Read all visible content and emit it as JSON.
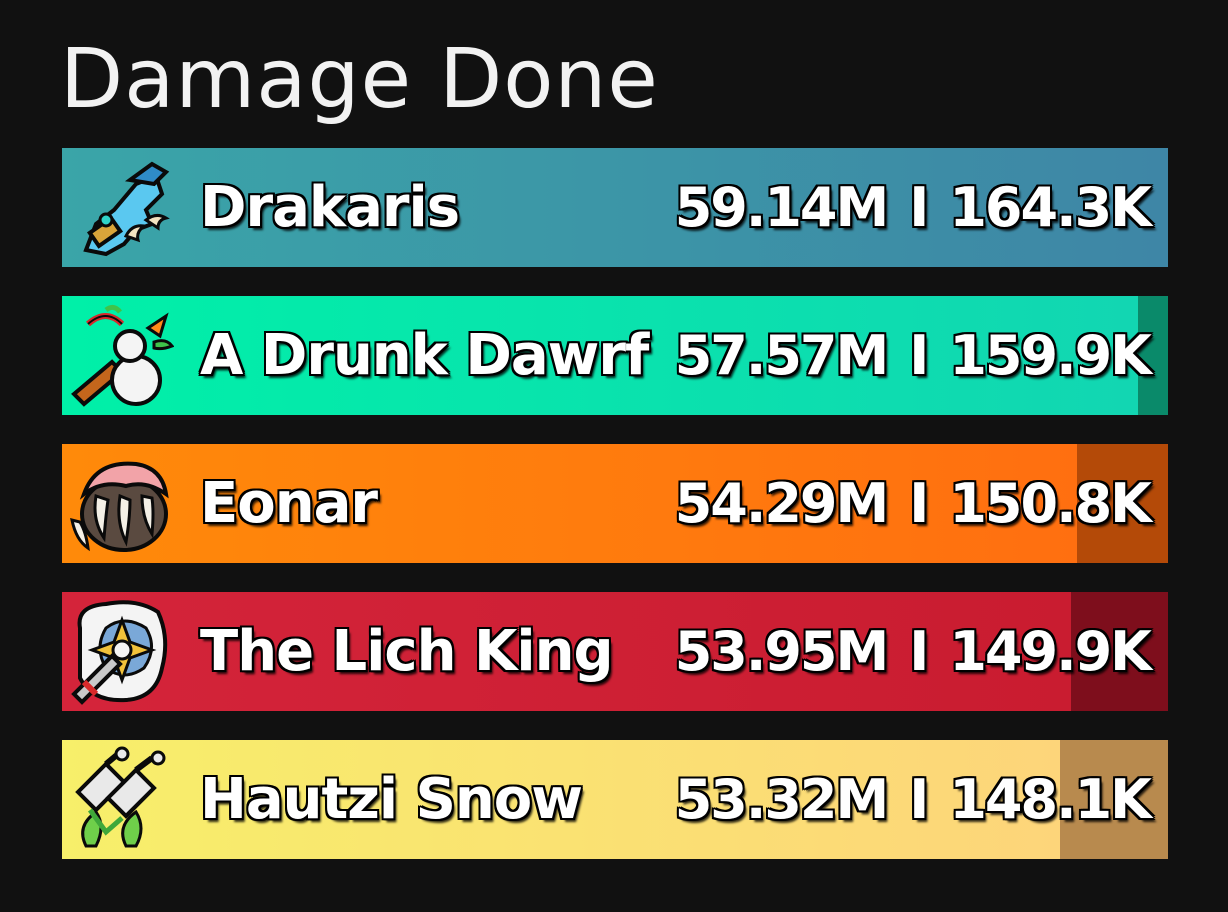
{
  "meter": {
    "title": "Damage Done",
    "separator": "I",
    "entries": [
      {
        "name": "Drakaris",
        "total": "59.14M",
        "per_second": "164.3K",
        "fill_fraction": 1.0,
        "color_light": "#3aa5a8",
        "color_dark": "#3e86a6",
        "rest_color": "#2f6f8a",
        "icon": "mage-hand-icon"
      },
      {
        "name": "A Drunk Dawrf",
        "total": "57.57M",
        "per_second": "159.9K",
        "fill_fraction": 0.973,
        "color_light": "#00f0a8",
        "color_dark": "#12d6b2",
        "rest_color": "#0a8a6a",
        "icon": "monk-gourd-icon"
      },
      {
        "name": "Eonar",
        "total": "54.29M",
        "per_second": "150.8K",
        "fill_fraction": 0.918,
        "color_light": "#ff8a0a",
        "color_dark": "#ff6f10",
        "rest_color": "#b44a08",
        "icon": "druid-paw-icon"
      },
      {
        "name": "The Lich King",
        "total": "53.95M",
        "per_second": "149.9K",
        "fill_fraction": 0.912,
        "color_light": "#d4243a",
        "color_dark": "#c91c30",
        "rest_color": "#7e0e1c",
        "icon": "death-knight-sword-icon"
      },
      {
        "name": "Hautzi Snow",
        "total": "53.32M",
        "per_second": "148.1K",
        "fill_fraction": 0.902,
        "color_light": "#f7ef6a",
        "color_dark": "#fdd57a",
        "rest_color": "#b88a4e",
        "icon": "rogue-daggers-icon"
      }
    ]
  }
}
